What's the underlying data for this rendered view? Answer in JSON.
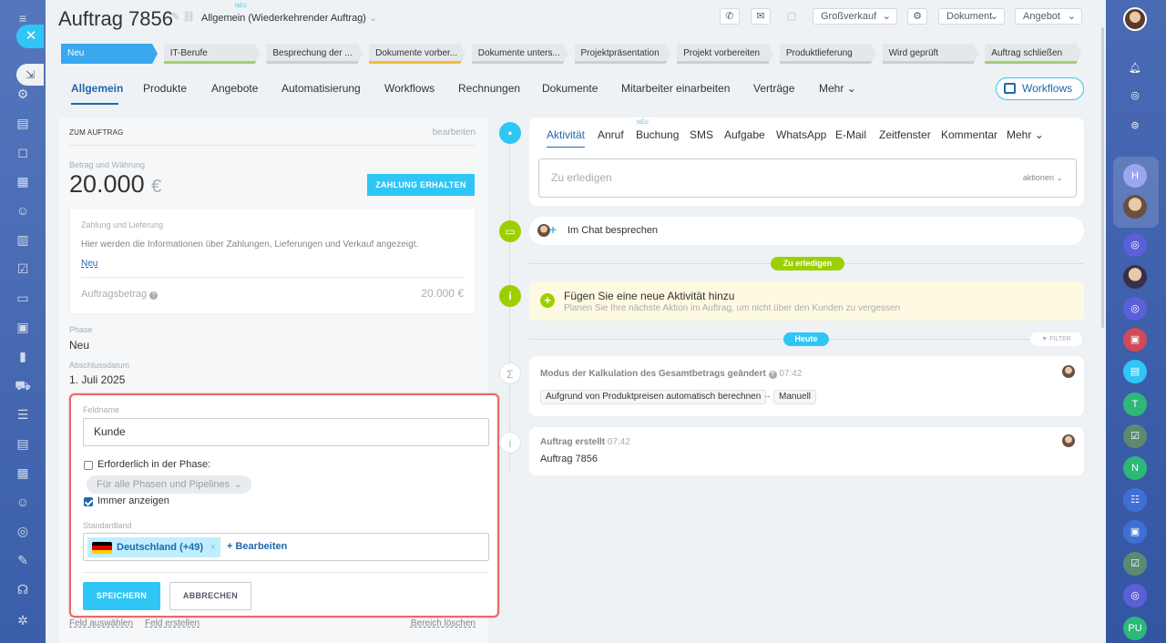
{
  "header": {
    "title": "Auftrag 7856",
    "subtitle": "Allgemein (Wiederkehrender Auftrag)",
    "new_badge": "NEU",
    "toolbar": {
      "grossverkauf": "Großverkauf",
      "dokument": "Dokument",
      "angebot": "Angebot"
    }
  },
  "stages": [
    {
      "label": "Neu",
      "color": "#39a8ef",
      "text_color": "#ffffff"
    },
    {
      "label": "IT-Berufe",
      "color": "#a1d16b",
      "text_color": "#333333"
    },
    {
      "label": "Besprechung der ...",
      "color": "#c8cfd6",
      "text_color": "#333333"
    },
    {
      "label": "Dokumente vorber...",
      "color": "#fbb73c",
      "text_color": "#333333"
    },
    {
      "label": "Dokumente unters...",
      "color": "#c8cfd6",
      "text_color": "#333333"
    },
    {
      "label": "Projektpräsentation",
      "color": "#c8cfd6",
      "text_color": "#333333"
    },
    {
      "label": "Projekt vorbereiten",
      "color": "#c8cfd6",
      "text_color": "#333333"
    },
    {
      "label": "Produktlieferung",
      "color": "#c8cfd6",
      "text_color": "#333333"
    },
    {
      "label": "Wird geprüft",
      "color": "#c8cfd6",
      "text_color": "#333333"
    },
    {
      "label": "Auftrag schließen",
      "color": "#a1d16b",
      "text_color": "#333333"
    }
  ],
  "tabs": [
    "Allgemein",
    "Produkte",
    "Angebote",
    "Automatisierung",
    "Workflows",
    "Rechnungen",
    "Dokumente",
    "Mitarbeiter einarbeiten",
    "Verträge",
    "Mehr"
  ],
  "workflows_button": "Workflows",
  "details": {
    "header": "ZUM AUFTRAG",
    "edit": "bearbeiten",
    "amount_label": "Betrag und Währung",
    "amount": "20.000",
    "currency": "€",
    "payment_button": "ZAHLUNG ERHALTEN",
    "payment_title": "Zahlung und Lieferung",
    "payment_info": "Hier werden die Informationen über Zahlungen, Lieferungen und Verkauf angezeigt.",
    "payment_new": "Neu",
    "order_amount_label": "Auftragsbetrag",
    "order_amount_value": "20.000 €",
    "phase_label": "Phase",
    "phase_value": "Neu",
    "close_date_label": "Abschlussdatum",
    "close_date_value": "1. Juli 2025"
  },
  "field_editor": {
    "field_name_label": "Feldname",
    "field_name_value": "Kunde",
    "required_label": "Erforderlich in der Phase:",
    "required_checked": false,
    "phase_select": "Für alle Phasen und Pipelines",
    "always_show_label": "Immer anzeigen",
    "always_show_checked": true,
    "default_country_label": "Standardland",
    "country_chip": "Deutschland (+49)",
    "add_link": "+ Bearbeiten",
    "save": "SPEICHERN",
    "cancel": "ABBRECHEN"
  },
  "footer_links": {
    "select_field": "Feld auswählen",
    "create_field": "Feld erstellen",
    "delete_section": "Bereich löschen"
  },
  "activity": {
    "tabs": [
      "Aktivität",
      "Anruf",
      "Buchung",
      "SMS",
      "Aufgabe",
      "WhatsApp",
      "E-Mail",
      "Zeitfenster",
      "Kommentar",
      "Mehr"
    ],
    "booking_badge": "NEU",
    "todo_placeholder": "Zu erledigen",
    "actions": "aktionen",
    "chat": "Im Chat besprechen",
    "todo_pill": "Zu erledigen",
    "add_title": "Fügen Sie eine neue Aktivität hinzu",
    "add_sub": "Planen Sie Ihre nächste Aktion im Auftrag, um nicht über den Kunden zu vergessen",
    "today_pill": "Heute",
    "filter": "FILTER",
    "event1_title": "Modus der Kalkulation des Gesamtbetrags geändert",
    "event1_time": "07:42",
    "event1_from": "Aufgrund von Produktpreisen automatisch berechnen",
    "event1_to": "Manuell",
    "event2_title": "Auftrag erstellt",
    "event2_time": "07:42",
    "event2_body": "Auftrag 7856"
  },
  "right_rail": {
    "items": [
      "H",
      "T",
      "N",
      "PU"
    ]
  }
}
